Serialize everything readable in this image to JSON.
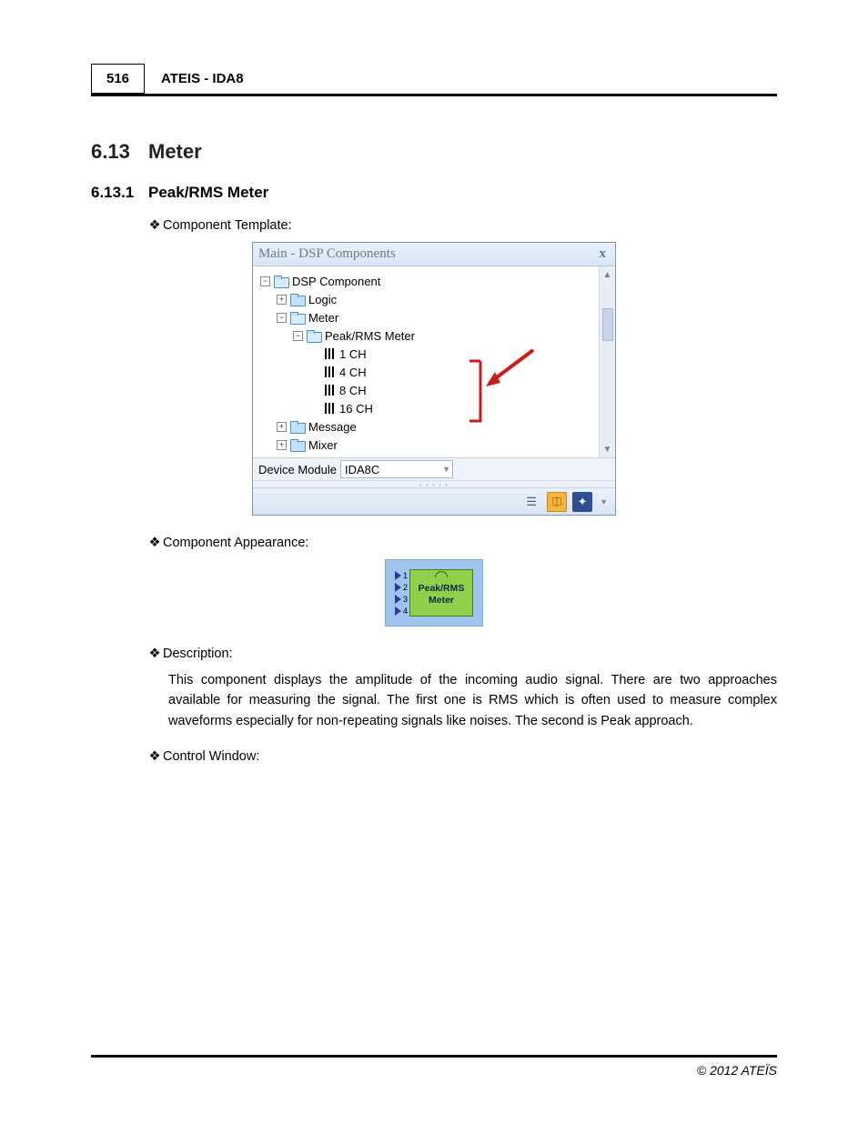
{
  "header": {
    "page_number": "516",
    "title": "ATEIS - IDA8"
  },
  "section": {
    "num": "6.13",
    "title": "Meter"
  },
  "subsection": {
    "num": "6.13.1",
    "title": "Peak/RMS Meter"
  },
  "labels": {
    "component_template": "Component Template:",
    "component_appearance": "Component Appearance:",
    "description": "Description:",
    "control_window": "Control Window:"
  },
  "dsp_panel": {
    "title": "Main - DSP Components",
    "tree": {
      "root": "DSP Component",
      "items": [
        {
          "label": "Logic",
          "expander": "+"
        },
        {
          "label": "Meter",
          "expander": "−",
          "open": true
        },
        {
          "label": "Peak/RMS Meter",
          "expander": "−",
          "open": true,
          "sub": true
        },
        {
          "label": "1 CH",
          "leaf": true
        },
        {
          "label": "4 CH",
          "leaf": true
        },
        {
          "label": "8 CH",
          "leaf": true
        },
        {
          "label": "16 CH",
          "leaf": true
        },
        {
          "label": "Message",
          "expander": "+"
        },
        {
          "label": "Mixer",
          "expander": "+"
        }
      ]
    },
    "device_module_label": "Device Module",
    "device_module_value": "IDA8C"
  },
  "appearance": {
    "ports": [
      "1",
      "2",
      "3",
      "4"
    ],
    "line1": "Peak/RMS",
    "line2": "Meter"
  },
  "description_text": "This component displays the amplitude of the incoming audio signal. There are two approaches available for measuring the signal. The first one is RMS which is often used to measure complex waveforms especially for non-repeating signals like noises. The second is Peak approach.",
  "footer": "© 2012 ATEÏS"
}
